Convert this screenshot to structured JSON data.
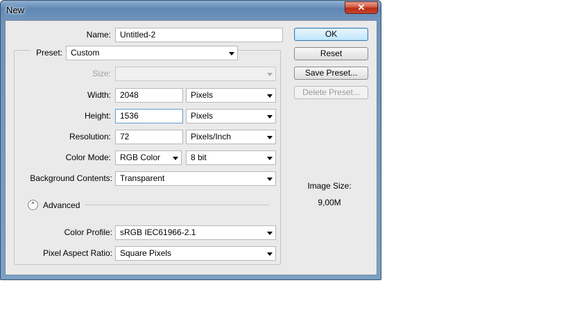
{
  "window": {
    "title": "New",
    "close_glyph": "✕"
  },
  "form": {
    "name_label": "Name:",
    "name_value": "Untitled-2",
    "preset_label": "Preset:",
    "preset_value": "Custom",
    "size_label": "Size:",
    "size_value": "",
    "width_label": "Width:",
    "width_value": "2048",
    "width_unit": "Pixels",
    "height_label": "Height:",
    "height_value": "1536",
    "height_unit": "Pixels",
    "resolution_label": "Resolution:",
    "resolution_value": "72",
    "resolution_unit": "Pixels/Inch",
    "color_mode_label": "Color Mode:",
    "color_mode_value": "RGB Color",
    "bit_depth_value": "8 bit",
    "background_label": "Background Contents:",
    "background_value": "Transparent",
    "advanced_label": "Advanced",
    "advanced_glyph": "⌃",
    "color_profile_label": "Color Profile:",
    "color_profile_value": "sRGB IEC61966-2.1",
    "pixel_aspect_label": "Pixel Aspect Ratio:",
    "pixel_aspect_value": "Square Pixels"
  },
  "buttons": {
    "ok": "OK",
    "reset": "Reset",
    "save_preset": "Save Preset...",
    "delete_preset": "Delete Preset..."
  },
  "info": {
    "image_size_label": "Image Size:",
    "image_size_value": "9,00M"
  },
  "icons": {
    "dropdown": "chevron-down-icon",
    "advanced_toggle": "chevron-up-circle-icon",
    "close": "close-icon"
  },
  "colors": {
    "title_bar": "#6d93bc",
    "client": "#eaeaea",
    "close_button": "#c9452b",
    "default_button": "#bee6fd",
    "focus_border": "#5c9fd6"
  }
}
